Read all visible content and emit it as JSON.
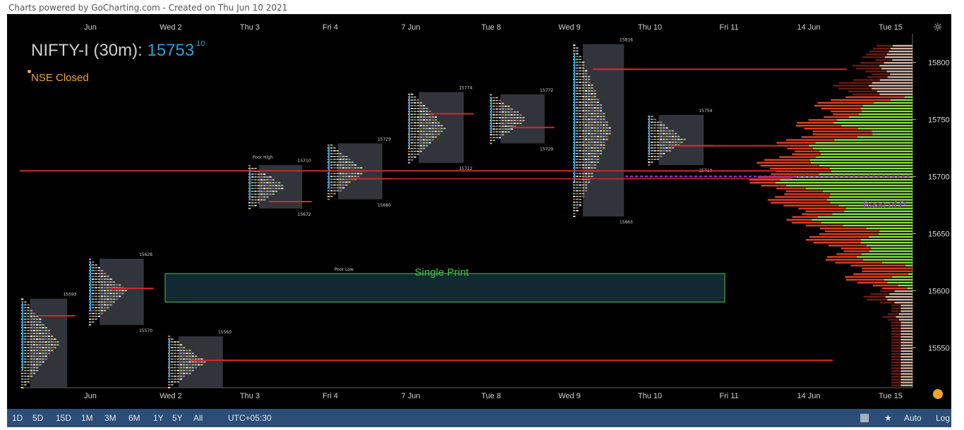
{
  "caption": "Charts powered by GoCharting.com - Created on Thu Jun 10 2021",
  "header": {
    "symbol": "NIFTY-I (30m):",
    "price": "15753",
    "price_decimal": ".10",
    "status": "NSE Closed"
  },
  "bottom_bar": {
    "timeframes": [
      "1D",
      "5D",
      "15D",
      "1M",
      "3M",
      "6M",
      "1Y",
      "5Y",
      "All"
    ],
    "timezone": "UTC+05:30",
    "right_auto": "Auto",
    "right_log": "Log"
  },
  "colors": {
    "background": "#000000",
    "profile_box": "#3a3d44",
    "poc_line": "#d7262e",
    "vah_val": "#e64a19",
    "vol_green": "#8fe24a",
    "ib_blue": "#2f9fd6",
    "single_print": "#3fc64a",
    "base_line": "#9c27d6"
  },
  "chart_data": {
    "type": "market-profile",
    "x_labels": [
      "Jun",
      "Wed 2",
      "Thu 3",
      "Fri 4",
      "7 Jun",
      "Tue 8",
      "Wed 9",
      "Thu 10",
      "Fri 11",
      "14 Jun",
      "Tue 15"
    ],
    "y_ticks": [
      15550,
      15600,
      15650,
      15700,
      15750,
      15800
    ],
    "y_range": [
      15515,
      15825
    ],
    "sessions": [
      {
        "day": "Jun",
        "high": 15593,
        "low": 15515,
        "poc": 15578,
        "va_high": 15593,
        "va_low": 15515,
        "high_label": "15593",
        "low_label": ""
      },
      {
        "day": "Jun-b",
        "high": 15628,
        "low": 15570,
        "poc": 15602,
        "va_high": 15628,
        "va_low": 15570,
        "high_label": "15628",
        "low_label": "15570"
      },
      {
        "day": "Wed 2",
        "high": 15560,
        "low": 15515,
        "poc": 15539,
        "va_high": 15560,
        "va_low": 15515,
        "high_label": "15560",
        "low_label": ""
      },
      {
        "day": "Thu 3",
        "high": 15710,
        "low": 15672,
        "poc": 15678,
        "va_high": 15710,
        "va_low": 15672,
        "high_label": "15710",
        "low_label": "15672"
      },
      {
        "day": "Fri 4",
        "high": 15729,
        "low": 15680,
        "poc": 15698,
        "va_high": 15729,
        "va_low": 15680,
        "high_label": "15729",
        "low_label": "15680"
      },
      {
        "day": "7 Jun",
        "high": 15774,
        "low": 15712,
        "poc": 15755,
        "va_high": 15774,
        "va_low": 15712,
        "high_label": "15774",
        "low_label": "15712"
      },
      {
        "day": "Tue 8",
        "high": 15772,
        "low": 15729,
        "poc": 15743,
        "va_high": 15772,
        "va_low": 15729,
        "high_label": "15772",
        "low_label": "15729"
      },
      {
        "day": "Wed 9",
        "high": 15816,
        "low": 15665,
        "poc": 15794,
        "va_high": 15816,
        "va_low": 15665,
        "high_label": "15816",
        "low_label": "15665"
      },
      {
        "day": "Thu 10",
        "high": 15754,
        "low": 15710,
        "poc": 15727,
        "va_high": 15754,
        "va_low": 15710,
        "high_label": "15754",
        "low_label": "15710"
      }
    ],
    "main_poc": 15705,
    "base_level": 15700,
    "single_print_zone": [
      15590,
      15615
    ],
    "annotations": [
      {
        "text": "Single Print",
        "color": "#3fc64a"
      },
      {
        "text": "Poor High"
      },
      {
        "text": "Poor Low"
      },
      {
        "text": "Base of P",
        "color": "#9c27d6"
      }
    ]
  }
}
